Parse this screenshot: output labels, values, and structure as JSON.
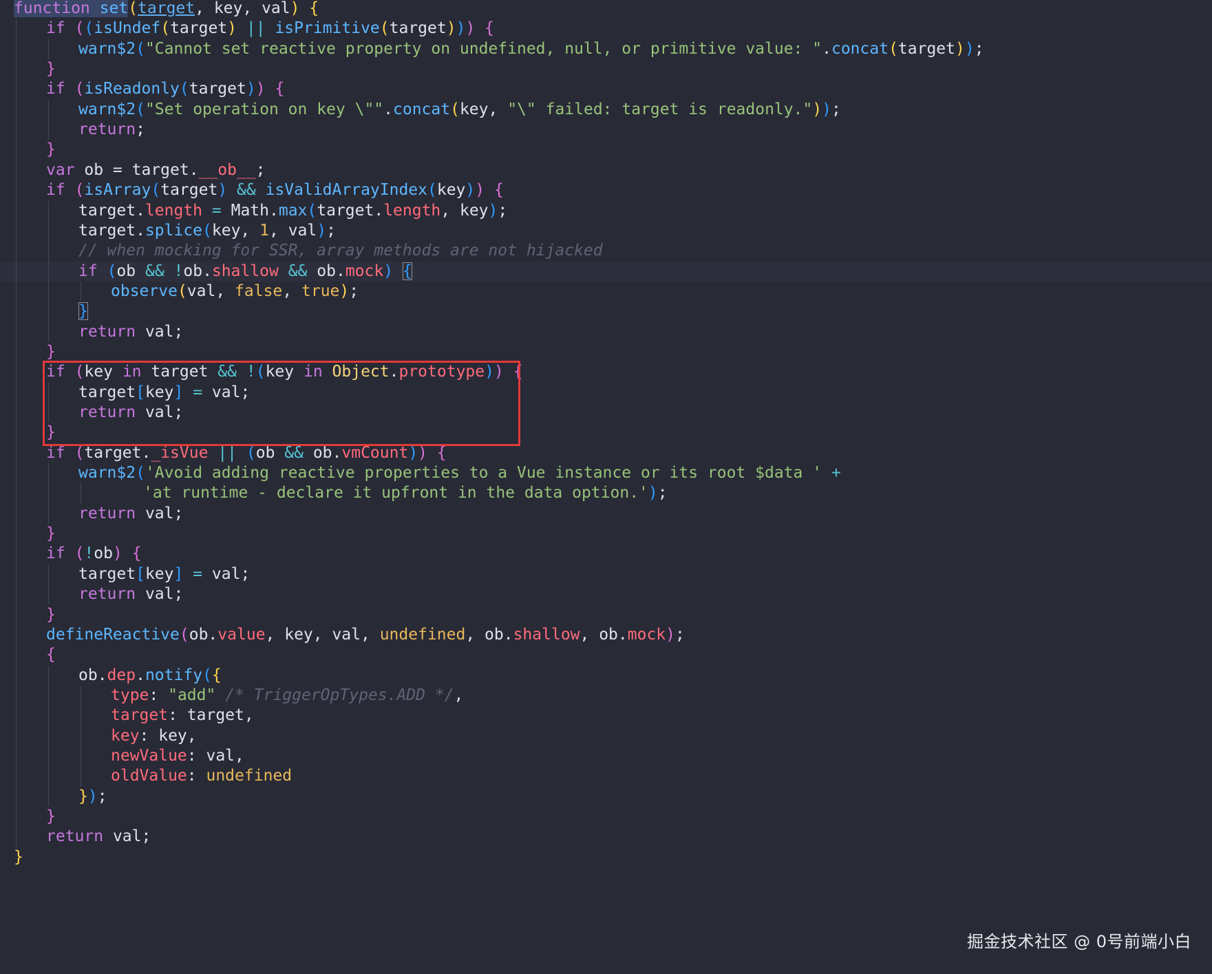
{
  "code_lines": [
    {
      "indent": 0,
      "segments": [
        [
          "function",
          "kw sel"
        ],
        [
          " ",
          "sel"
        ],
        [
          "set",
          "fn sel"
        ],
        [
          "(",
          "b1"
        ],
        [
          "target",
          "pm"
        ],
        [
          ", key, val",
          "pa"
        ],
        [
          ")",
          "b1"
        ],
        [
          " ",
          "pa"
        ],
        [
          "{",
          "b1"
        ]
      ]
    },
    {
      "indent": 1,
      "segments": [
        [
          "if",
          "kw"
        ],
        [
          " ",
          "pa"
        ],
        [
          "(",
          "b2"
        ],
        [
          "(",
          "b3"
        ],
        [
          "isUndef",
          "fn"
        ],
        [
          "(",
          "b1"
        ],
        [
          "target",
          "pa"
        ],
        [
          ")",
          "b1"
        ],
        [
          " ",
          "pa"
        ],
        [
          "||",
          "op"
        ],
        [
          " ",
          "pa"
        ],
        [
          "isPrimitive",
          "fn"
        ],
        [
          "(",
          "b1"
        ],
        [
          "target",
          "pa"
        ],
        [
          ")",
          "b1"
        ],
        [
          ")",
          "b3"
        ],
        [
          ")",
          "b2"
        ],
        [
          " ",
          "pa"
        ],
        [
          "{",
          "b2"
        ]
      ]
    },
    {
      "indent": 2,
      "segments": [
        [
          "warn$2",
          "fn"
        ],
        [
          "(",
          "b3"
        ],
        [
          "\"Cannot set reactive property on undefined, null, or primitive value: \"",
          "st"
        ],
        [
          ".",
          "pa"
        ],
        [
          "concat",
          "fn"
        ],
        [
          "(",
          "b1"
        ],
        [
          "target",
          "pa"
        ],
        [
          ")",
          "b1"
        ],
        [
          ")",
          "b3"
        ],
        [
          ";",
          "pa"
        ]
      ]
    },
    {
      "indent": 1,
      "segments": [
        [
          "}",
          "b2"
        ]
      ]
    },
    {
      "indent": 1,
      "segments": [
        [
          "if",
          "kw"
        ],
        [
          " ",
          "pa"
        ],
        [
          "(",
          "b2"
        ],
        [
          "isReadonly",
          "fn"
        ],
        [
          "(",
          "b3"
        ],
        [
          "target",
          "pa"
        ],
        [
          ")",
          "b3"
        ],
        [
          ")",
          "b2"
        ],
        [
          " ",
          "pa"
        ],
        [
          "{",
          "b2"
        ]
      ]
    },
    {
      "indent": 2,
      "segments": [
        [
          "warn$2",
          "fn"
        ],
        [
          "(",
          "b3"
        ],
        [
          "\"Set operation on key \\\"\"",
          "st"
        ],
        [
          ".",
          "pa"
        ],
        [
          "concat",
          "fn"
        ],
        [
          "(",
          "b1"
        ],
        [
          "key, ",
          "pa"
        ],
        [
          "\"\\\" failed: target is readonly.\"",
          "st"
        ],
        [
          ")",
          "b1"
        ],
        [
          ")",
          "b3"
        ],
        [
          ";",
          "pa"
        ]
      ]
    },
    {
      "indent": 2,
      "segments": [
        [
          "return",
          "kw"
        ],
        [
          ";",
          "pa"
        ]
      ]
    },
    {
      "indent": 1,
      "segments": [
        [
          "}",
          "b2"
        ]
      ]
    },
    {
      "indent": 1,
      "segments": [
        [
          "var",
          "kw"
        ],
        [
          " ob = target.",
          "pa"
        ],
        [
          "__ob__",
          "pr"
        ],
        [
          ";",
          "pa"
        ]
      ]
    },
    {
      "indent": 1,
      "segments": [
        [
          "if",
          "kw"
        ],
        [
          " ",
          "pa"
        ],
        [
          "(",
          "b2"
        ],
        [
          "isArray",
          "fn"
        ],
        [
          "(",
          "b3"
        ],
        [
          "target",
          "pa"
        ],
        [
          ")",
          "b3"
        ],
        [
          " ",
          "pa"
        ],
        [
          "&&",
          "op"
        ],
        [
          " ",
          "pa"
        ],
        [
          "isValidArrayIndex",
          "fn"
        ],
        [
          "(",
          "b3"
        ],
        [
          "key",
          "pa"
        ],
        [
          ")",
          "b3"
        ],
        [
          ")",
          "b2"
        ],
        [
          " ",
          "pa"
        ],
        [
          "{",
          "b2"
        ]
      ]
    },
    {
      "indent": 2,
      "segments": [
        [
          "target.",
          "pa"
        ],
        [
          "length",
          "pr"
        ],
        [
          " ",
          "pa"
        ],
        [
          "=",
          "op"
        ],
        [
          " Math.",
          "pa"
        ],
        [
          "max",
          "fn"
        ],
        [
          "(",
          "b3"
        ],
        [
          "target.",
          "pa"
        ],
        [
          "length",
          "pr"
        ],
        [
          ", key",
          "pa"
        ],
        [
          ")",
          "b3"
        ],
        [
          ";",
          "pa"
        ]
      ]
    },
    {
      "indent": 2,
      "segments": [
        [
          "target.",
          "pa"
        ],
        [
          "splice",
          "fn"
        ],
        [
          "(",
          "b3"
        ],
        [
          "key, ",
          "pa"
        ],
        [
          "1",
          "co"
        ],
        [
          ", val",
          "pa"
        ],
        [
          ")",
          "b3"
        ],
        [
          ";",
          "pa"
        ]
      ]
    },
    {
      "indent": 2,
      "segments": [
        [
          "// when mocking for SSR, array methods are not hijacked",
          "cm"
        ]
      ]
    },
    {
      "indent": 2,
      "current": true,
      "segments": [
        [
          "if",
          "kw"
        ],
        [
          " ",
          "pa"
        ],
        [
          "(",
          "b3"
        ],
        [
          "ob ",
          "pa"
        ],
        [
          "&&",
          "op"
        ],
        [
          " ",
          "pa"
        ],
        [
          "!",
          "op"
        ],
        [
          "ob.",
          "pa"
        ],
        [
          "shallow",
          "pr"
        ],
        [
          " ",
          "pa"
        ],
        [
          "&&",
          "op"
        ],
        [
          " ob.",
          "pa"
        ],
        [
          "mock",
          "pr"
        ],
        [
          ")",
          "b3"
        ],
        [
          " ",
          "pa"
        ],
        [
          "{",
          "b3 bm"
        ]
      ]
    },
    {
      "indent": 3,
      "segments": [
        [
          "observe",
          "fn"
        ],
        [
          "(",
          "b1"
        ],
        [
          "val, ",
          "pa"
        ],
        [
          "false",
          "co"
        ],
        [
          ", ",
          "pa"
        ],
        [
          "true",
          "co"
        ],
        [
          ")",
          "b1"
        ],
        [
          ";",
          "pa"
        ]
      ]
    },
    {
      "indent": 2,
      "segments": [
        [
          "}",
          "b3 bm"
        ]
      ]
    },
    {
      "indent": 2,
      "segments": [
        [
          "return",
          "kw"
        ],
        [
          " val;",
          "pa"
        ]
      ]
    },
    {
      "indent": 1,
      "segments": [
        [
          "}",
          "b2"
        ]
      ]
    },
    {
      "indent": 1,
      "segments": [
        [
          "if",
          "kw"
        ],
        [
          " ",
          "pa"
        ],
        [
          "(",
          "b2"
        ],
        [
          "key ",
          "pa"
        ],
        [
          "in",
          "kw"
        ],
        [
          " target ",
          "pa"
        ],
        [
          "&&",
          "op"
        ],
        [
          " ",
          "pa"
        ],
        [
          "!",
          "op"
        ],
        [
          "(",
          "b3"
        ],
        [
          "key ",
          "pa"
        ],
        [
          "in",
          "kw"
        ],
        [
          " ",
          "pa"
        ],
        [
          "Object",
          "ty"
        ],
        [
          ".",
          "pa"
        ],
        [
          "prototype",
          "pr"
        ],
        [
          ")",
          "b3"
        ],
        [
          ")",
          "b2"
        ],
        [
          " ",
          "pa"
        ],
        [
          "{",
          "b2"
        ]
      ]
    },
    {
      "indent": 2,
      "segments": [
        [
          "target",
          "pa"
        ],
        [
          "[",
          "b3"
        ],
        [
          "key",
          "pa"
        ],
        [
          "]",
          "b3"
        ],
        [
          " ",
          "pa"
        ],
        [
          "=",
          "op"
        ],
        [
          " val;",
          "pa"
        ]
      ]
    },
    {
      "indent": 2,
      "segments": [
        [
          "return",
          "kw"
        ],
        [
          " val;",
          "pa"
        ]
      ]
    },
    {
      "indent": 1,
      "segments": [
        [
          "}",
          "b2"
        ]
      ]
    },
    {
      "indent": 1,
      "segments": [
        [
          "if",
          "kw"
        ],
        [
          " ",
          "pa"
        ],
        [
          "(",
          "b2"
        ],
        [
          "target.",
          "pa"
        ],
        [
          "_isVue",
          "pr"
        ],
        [
          " ",
          "pa"
        ],
        [
          "||",
          "op"
        ],
        [
          " ",
          "pa"
        ],
        [
          "(",
          "b3"
        ],
        [
          "ob ",
          "pa"
        ],
        [
          "&&",
          "op"
        ],
        [
          " ob.",
          "pa"
        ],
        [
          "vmCount",
          "pr"
        ],
        [
          ")",
          "b3"
        ],
        [
          ")",
          "b2"
        ],
        [
          " ",
          "pa"
        ],
        [
          "{",
          "b2"
        ]
      ]
    },
    {
      "indent": 2,
      "segments": [
        [
          "warn$2",
          "fn"
        ],
        [
          "(",
          "b3"
        ],
        [
          "'Avoid adding reactive properties to a Vue instance or its root $data '",
          "st"
        ],
        [
          " ",
          "pa"
        ],
        [
          "+",
          "op"
        ]
      ]
    },
    {
      "indent": 4,
      "segments": [
        [
          "'at runtime - declare it upfront in the data option.'",
          "st"
        ],
        [
          ")",
          "b3"
        ],
        [
          ";",
          "pa"
        ]
      ]
    },
    {
      "indent": 2,
      "segments": [
        [
          "return",
          "kw"
        ],
        [
          " val;",
          "pa"
        ]
      ]
    },
    {
      "indent": 1,
      "segments": [
        [
          "}",
          "b2"
        ]
      ]
    },
    {
      "indent": 1,
      "segments": [
        [
          "if",
          "kw"
        ],
        [
          " ",
          "pa"
        ],
        [
          "(",
          "b2"
        ],
        [
          "!",
          "op"
        ],
        [
          "ob",
          "pa"
        ],
        [
          ")",
          "b2"
        ],
        [
          " ",
          "pa"
        ],
        [
          "{",
          "b2"
        ]
      ]
    },
    {
      "indent": 2,
      "segments": [
        [
          "target",
          "pa"
        ],
        [
          "[",
          "b3"
        ],
        [
          "key",
          "pa"
        ],
        [
          "]",
          "b3"
        ],
        [
          " ",
          "pa"
        ],
        [
          "=",
          "op"
        ],
        [
          " val;",
          "pa"
        ]
      ]
    },
    {
      "indent": 2,
      "segments": [
        [
          "return",
          "kw"
        ],
        [
          " val;",
          "pa"
        ]
      ]
    },
    {
      "indent": 1,
      "segments": [
        [
          "}",
          "b2"
        ]
      ]
    },
    {
      "indent": 1,
      "segments": [
        [
          "defineReactive",
          "fn"
        ],
        [
          "(",
          "b2"
        ],
        [
          "ob.",
          "pa"
        ],
        [
          "value",
          "pr"
        ],
        [
          ", key, val, ",
          "pa"
        ],
        [
          "undefined",
          "co"
        ],
        [
          ", ob.",
          "pa"
        ],
        [
          "shallow",
          "pr"
        ],
        [
          ", ob.",
          "pa"
        ],
        [
          "mock",
          "pr"
        ],
        [
          ")",
          "b2"
        ],
        [
          ";",
          "pa"
        ]
      ]
    },
    {
      "indent": 1,
      "segments": [
        [
          "{",
          "b2"
        ]
      ]
    },
    {
      "indent": 2,
      "segments": [
        [
          "ob.",
          "pa"
        ],
        [
          "dep",
          "pr"
        ],
        [
          ".",
          "pa"
        ],
        [
          "notify",
          "fn"
        ],
        [
          "(",
          "b3"
        ],
        [
          "{",
          "b1"
        ]
      ]
    },
    {
      "indent": 3,
      "segments": [
        [
          "type",
          "pr"
        ],
        [
          ": ",
          "pa"
        ],
        [
          "\"add\"",
          "st"
        ],
        [
          " ",
          "pa"
        ],
        [
          "/* TriggerOpTypes.ADD */",
          "cm"
        ],
        [
          ",",
          "pa"
        ]
      ]
    },
    {
      "indent": 3,
      "segments": [
        [
          "target",
          "pr"
        ],
        [
          ": target,",
          "pa"
        ]
      ]
    },
    {
      "indent": 3,
      "segments": [
        [
          "key",
          "pr"
        ],
        [
          ": key,",
          "pa"
        ]
      ]
    },
    {
      "indent": 3,
      "segments": [
        [
          "newValue",
          "pr"
        ],
        [
          ": val,",
          "pa"
        ]
      ]
    },
    {
      "indent": 3,
      "segments": [
        [
          "oldValue",
          "pr"
        ],
        [
          ": ",
          "pa"
        ],
        [
          "undefined",
          "co"
        ]
      ]
    },
    {
      "indent": 2,
      "segments": [
        [
          "}",
          "b1"
        ],
        [
          ")",
          "b3"
        ],
        [
          ";",
          "pa"
        ]
      ]
    },
    {
      "indent": 1,
      "segments": [
        [
          "}",
          "b2"
        ]
      ]
    },
    {
      "indent": 1,
      "segments": [
        [
          "return",
          "kw"
        ],
        [
          " val;",
          "pa"
        ]
      ]
    },
    {
      "indent": 0,
      "segments": [
        [
          "}",
          "b1"
        ]
      ]
    }
  ],
  "highlight": {
    "color": "#e23a3a",
    "first_line": 18,
    "last_line": 21
  },
  "watermark": "掘金技术社区 @ 0号前端小白",
  "colors": {
    "background": "#282a36",
    "keyword": "#c678dd",
    "function": "#5db7ff",
    "string": "#98c379",
    "property": "#ff6b7b",
    "comment": "#5f6375",
    "constant": "#e8b85b",
    "operator": "#56c4d4"
  }
}
